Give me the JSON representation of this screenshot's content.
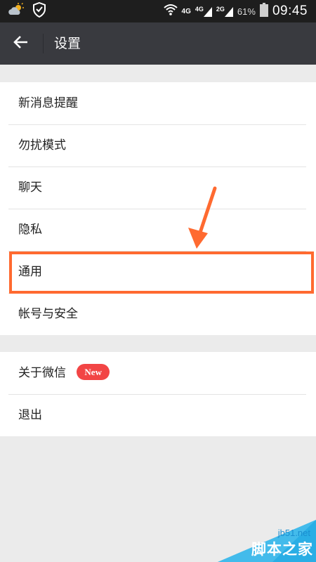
{
  "status_bar": {
    "network1": "4G",
    "network2": "4G",
    "network3": "2G",
    "battery_percent": "61%",
    "time": "09:45"
  },
  "title_bar": {
    "title": "设置"
  },
  "settings_group1": [
    {
      "label": "新消息提醒"
    },
    {
      "label": "勿扰模式"
    },
    {
      "label": "聊天"
    },
    {
      "label": "隐私"
    },
    {
      "label": "通用"
    },
    {
      "label": "帐号与安全"
    }
  ],
  "settings_group2": [
    {
      "label": "关于微信",
      "badge": "New"
    },
    {
      "label": "退出"
    }
  ],
  "annotation": {
    "highlighted_item": "通用",
    "color": "#ff6a30"
  },
  "watermark": {
    "site": "jb51.net",
    "name": "脚本之家"
  },
  "colors": {
    "title_bar": "#393a3f",
    "status_bar": "#1e1e1e",
    "badge": "#f24545",
    "background": "#ebebeb"
  }
}
